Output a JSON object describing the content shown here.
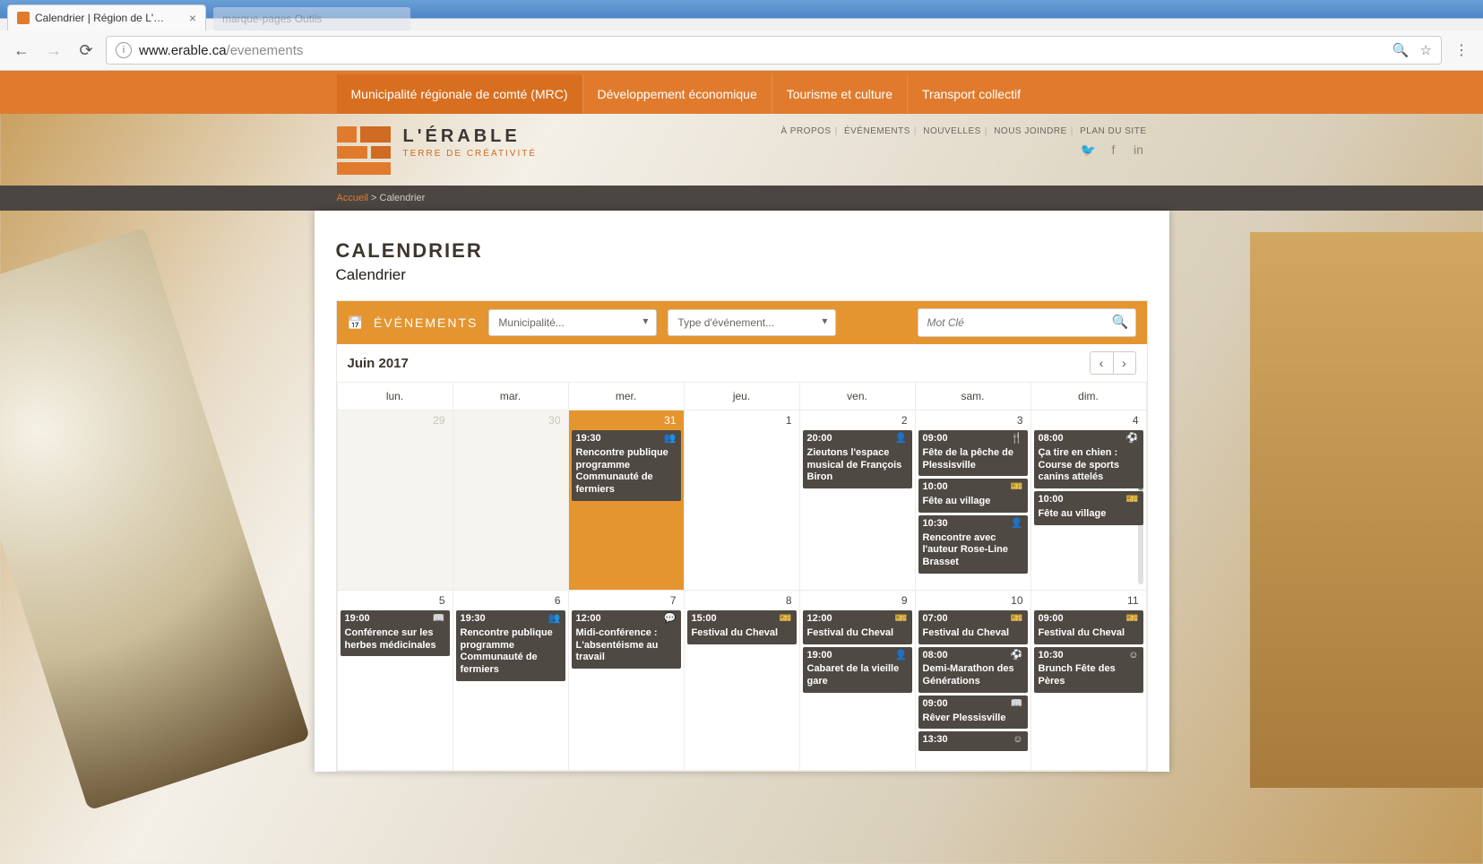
{
  "browser": {
    "tab_title": "Calendrier | Région de L'…",
    "url_domain": "www.erable.ca",
    "url_path": "/evenements",
    "ghost_tab": "marque-pages   Outils"
  },
  "mainnav": {
    "items": [
      "Municipalité régionale de comté (MRC)",
      "Développement économique",
      "Tourisme et culture",
      "Transport collectif"
    ]
  },
  "util": {
    "links": [
      "À PROPOS",
      "ÉVÉNEMENTS",
      "NOUVELLES",
      "NOUS JOINDRE",
      "PLAN DU SITE"
    ]
  },
  "logo": {
    "line1": "L'ÉRABLE",
    "line2": "TERRE DE CRÉATIVITÉ"
  },
  "breadcrumb": {
    "home": "Accueil",
    "sep": " > ",
    "current": "Calendrier"
  },
  "page": {
    "title": "CALENDRIER",
    "subtitle": "Calendrier"
  },
  "filters": {
    "lead": "ÉVÉNEMENTS",
    "municipality_placeholder": "Municipalité...",
    "type_placeholder": "Type d'événement...",
    "search_placeholder": "Mot Clé"
  },
  "calendar": {
    "month_label": "Juin 2017",
    "weekdays": [
      "lun.",
      "mar.",
      "mer.",
      "jeu.",
      "ven.",
      "sam.",
      "dim."
    ],
    "rows": [
      [
        {
          "num": "29",
          "other": true,
          "events": []
        },
        {
          "num": "30",
          "other": true,
          "events": []
        },
        {
          "num": "31",
          "other": true,
          "today": true,
          "events": [
            {
              "time": "19:30",
              "icon": "👥",
              "title": "Rencontre publique programme Communauté de fermiers"
            }
          ]
        },
        {
          "num": "1",
          "events": []
        },
        {
          "num": "2",
          "events": [
            {
              "time": "20:00",
              "icon": "👤",
              "title": "Zieutons l'espace musical de François Biron"
            }
          ]
        },
        {
          "num": "3",
          "events": [
            {
              "time": "09:00",
              "icon": "🍴",
              "title": "Fête de la pêche de Plessisville"
            },
            {
              "time": "10:00",
              "icon": "🎫",
              "title": "Fête au village"
            },
            {
              "time": "10:30",
              "icon": "👤",
              "title": "Rencontre avec l'auteur Rose-Line Brasset"
            }
          ]
        },
        {
          "num": "4",
          "scroll": true,
          "events": [
            {
              "time": "08:00",
              "icon": "⚽",
              "title": "Ça tire en chien : Course de sports canins attelés"
            },
            {
              "time": "10:00",
              "icon": "🎫",
              "title": "Fête au village"
            }
          ]
        }
      ],
      [
        {
          "num": "5",
          "events": [
            {
              "time": "19:00",
              "icon": "📖",
              "title": "Conférence sur les herbes médicinales"
            }
          ]
        },
        {
          "num": "6",
          "events": [
            {
              "time": "19:30",
              "icon": "👥",
              "title": "Rencontre publique programme Communauté de fermiers"
            }
          ]
        },
        {
          "num": "7",
          "events": [
            {
              "time": "12:00",
              "icon": "💬",
              "title": "Midi-conférence : L'absentéisme au travail"
            }
          ]
        },
        {
          "num": "8",
          "events": [
            {
              "time": "15:00",
              "icon": "🎫",
              "title": "Festival du Cheval"
            }
          ]
        },
        {
          "num": "9",
          "events": [
            {
              "time": "12:00",
              "icon": "🎫",
              "title": "Festival du Cheval"
            },
            {
              "time": "19:00",
              "icon": "👤",
              "title": "Cabaret de la vieille gare"
            }
          ]
        },
        {
          "num": "10",
          "events": [
            {
              "time": "07:00",
              "icon": "🎫",
              "title": "Festival du Cheval"
            },
            {
              "time": "08:00",
              "icon": "⚽",
              "title": "Demi-Marathon des Générations"
            },
            {
              "time": "09:00",
              "icon": "📖",
              "title": "Rêver Plessisville"
            },
            {
              "time": "13:30",
              "icon": "☺",
              "title": ""
            }
          ]
        },
        {
          "num": "11",
          "events": [
            {
              "time": "09:00",
              "icon": "🎫",
              "title": "Festival du Cheval"
            },
            {
              "time": "10:30",
              "icon": "☺",
              "title": "Brunch Fête des Pères"
            }
          ]
        }
      ]
    ]
  }
}
